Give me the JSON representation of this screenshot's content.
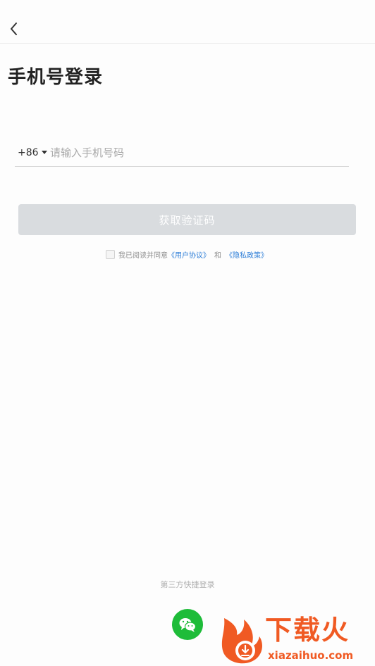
{
  "header": {
    "back_icon": "chevron-left-icon"
  },
  "page": {
    "title": "手机号登录"
  },
  "phone": {
    "country_code": "+86",
    "caret_icon": "caret-down-icon",
    "placeholder": "请输入手机号码",
    "value": ""
  },
  "actions": {
    "get_code_label": "获取验证码",
    "get_code_disabled": true
  },
  "agreement": {
    "checked": false,
    "prefix": "我已阅读并同意",
    "user_agreement": "《用户协议》",
    "and": "和",
    "privacy_policy": "《隐私政策》"
  },
  "third_party": {
    "label": "第三方快捷登录",
    "wechat_icon": "wechat-icon"
  },
  "watermark": {
    "brand": "下载火",
    "url": "xiazaihuo.com"
  },
  "colors": {
    "accent_link": "#2f7fd8",
    "button_disabled": "#d9dcdf",
    "wechat_green": "#1ebc39",
    "watermark_orange": "#f05a23"
  }
}
